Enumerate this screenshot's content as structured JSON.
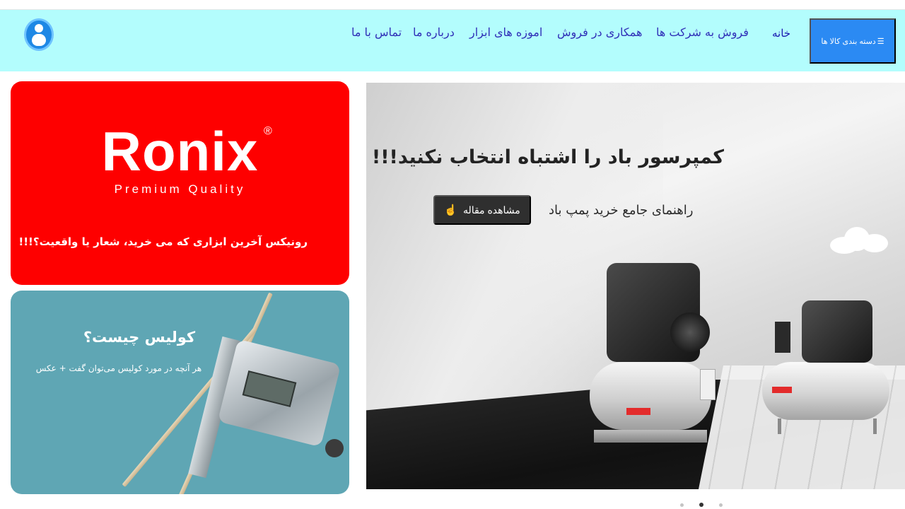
{
  "header": {
    "category_button": "دسته بندی کالا ها",
    "nav": [
      "خانه",
      "فروش به شرکت ها",
      "همکاری در فروش",
      "اموزه های ابزار",
      "درباره ما",
      "تماس با ما"
    ]
  },
  "slider": {
    "title": "کمپرسور باد را اشتباه انتخاب نکنید!!!",
    "subtitle": "راهنمای جامع خرید پمپ باد",
    "button": "مشاهده مقاله",
    "active_slide_index": 1,
    "slide_count": 3
  },
  "cards": {
    "ronix": {
      "logo": "Ronix",
      "registered": "®",
      "tagline": "Premium Quality",
      "caption": "رونیکس آخرین ابزاری که می خرید، شعار یا واقعیت؟!!!",
      "background": "#fe0000"
    },
    "caliper": {
      "title": "کولیس چیست؟",
      "subtitle": "هر آنچه در مورد کولیس می‌توان گفت + عکس",
      "background": "#5fa6b4"
    }
  },
  "colors": {
    "navbar": "#b3fdfd",
    "category_button": "#2b8af3",
    "nav_link": "#3030b8"
  }
}
